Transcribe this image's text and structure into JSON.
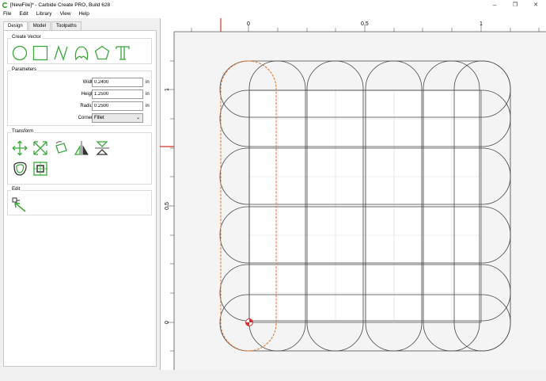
{
  "window": {
    "title": "[NewFile]* - Carbide Create PRO, Build 628",
    "minimize": "–",
    "restore": "❐",
    "close": "✕"
  },
  "menu": [
    "File",
    "Edit",
    "Library",
    "View",
    "Help"
  ],
  "tabs": [
    "Design",
    "Model",
    "Toolpaths"
  ],
  "groups": {
    "create_vector": "Create Vector",
    "parameters": "Parameters",
    "transform": "Transform",
    "edit": "Edit"
  },
  "parameters": {
    "width_label": "Width",
    "width_value": "0.2400",
    "height_label": "Height",
    "height_value": "1.2500",
    "radius_label": "Radius",
    "radius_value": "0.2500",
    "corners_label": "Corners",
    "corners_value": "Fillet",
    "unit": "in"
  },
  "ruler": {
    "h_labels": [
      "0",
      "0.5",
      "1"
    ],
    "v_labels": [
      "1",
      "0.5",
      "0"
    ]
  },
  "colors": {
    "icon_green": "#3aa83a",
    "selection_orange": "#e07b3c",
    "ruler_marker": "#d23030"
  }
}
